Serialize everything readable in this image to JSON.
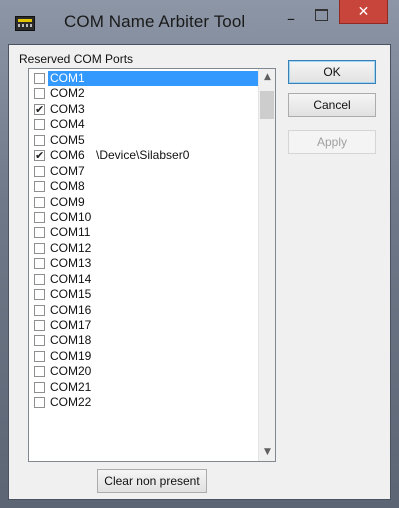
{
  "window": {
    "title": "COM Name Arbiter Tool",
    "minimize_glyph": "–",
    "close_glyph": "✕"
  },
  "group": {
    "label": "Reserved COM Ports"
  },
  "ports": [
    {
      "name": "COM1",
      "checked": false,
      "selected": true,
      "device": ""
    },
    {
      "name": "COM2",
      "checked": false,
      "selected": false,
      "device": ""
    },
    {
      "name": "COM3",
      "checked": true,
      "selected": false,
      "device": ""
    },
    {
      "name": "COM4",
      "checked": false,
      "selected": false,
      "device": ""
    },
    {
      "name": "COM5",
      "checked": false,
      "selected": false,
      "device": ""
    },
    {
      "name": "COM6",
      "checked": true,
      "selected": false,
      "device": "\\Device\\Silabser0"
    },
    {
      "name": "COM7",
      "checked": false,
      "selected": false,
      "device": ""
    },
    {
      "name": "COM8",
      "checked": false,
      "selected": false,
      "device": ""
    },
    {
      "name": "COM9",
      "checked": false,
      "selected": false,
      "device": ""
    },
    {
      "name": "COM10",
      "checked": false,
      "selected": false,
      "device": ""
    },
    {
      "name": "COM11",
      "checked": false,
      "selected": false,
      "device": ""
    },
    {
      "name": "COM12",
      "checked": false,
      "selected": false,
      "device": ""
    },
    {
      "name": "COM13",
      "checked": false,
      "selected": false,
      "device": ""
    },
    {
      "name": "COM14",
      "checked": false,
      "selected": false,
      "device": ""
    },
    {
      "name": "COM15",
      "checked": false,
      "selected": false,
      "device": ""
    },
    {
      "name": "COM16",
      "checked": false,
      "selected": false,
      "device": ""
    },
    {
      "name": "COM17",
      "checked": false,
      "selected": false,
      "device": ""
    },
    {
      "name": "COM18",
      "checked": false,
      "selected": false,
      "device": ""
    },
    {
      "name": "COM19",
      "checked": false,
      "selected": false,
      "device": ""
    },
    {
      "name": "COM20",
      "checked": false,
      "selected": false,
      "device": ""
    },
    {
      "name": "COM21",
      "checked": false,
      "selected": false,
      "device": ""
    },
    {
      "name": "COM22",
      "checked": false,
      "selected": false,
      "device": ""
    }
  ],
  "buttons": {
    "ok": "OK",
    "cancel": "Cancel",
    "apply": "Apply",
    "clear": "Clear non present"
  },
  "icons": {
    "app": "serial-port-icon",
    "minimize": "minimize-icon",
    "maximize": "maximize-icon",
    "close": "close-icon",
    "scroll_up": "chevron-up-icon",
    "scroll_down": "chevron-down-icon",
    "check": "checkmark-icon"
  },
  "colors": {
    "selection": "#3399ff",
    "close_button": "#c7453a",
    "dialog_bg": "#f0f0f0"
  }
}
